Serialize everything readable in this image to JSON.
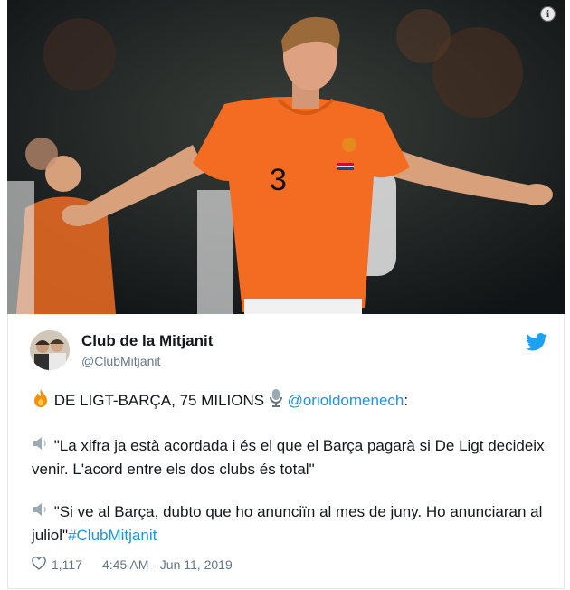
{
  "media": {
    "info_icon_glyph": "i",
    "jersey_number": "3",
    "colors": {
      "kit_orange": "#f36c21",
      "background": "#1c2023"
    }
  },
  "tweet": {
    "display_name": "Club de la Mitjanit",
    "handle": "@ClubMitjanit",
    "line1_text": " DE LIGT-BARÇA, 75 MILIONS ",
    "line1_mention": "@orioldomenech",
    "line1_tail": ":",
    "quote1": " \"La xifra ja està acordada i és el que el Barça pagarà si De Ligt decideix venir. L'acord entre els dos clubs és total\"",
    "quote2": " \"Si ve al Barça, dubto que ho anunciïn al mes de juny. Ho anunciaran al juliol\"",
    "hashtag": "#ClubMitjanit",
    "likes": "1,117",
    "timestamp": "4:45 AM - Jun 11, 2019",
    "icons": [
      "fire-icon",
      "microphone-icon",
      "speaker-icon",
      "heart-icon",
      "twitter-bird-icon"
    ],
    "colors": {
      "link": "#1b95e0",
      "secondary": "#657786",
      "bird": "#1da1f2"
    }
  }
}
